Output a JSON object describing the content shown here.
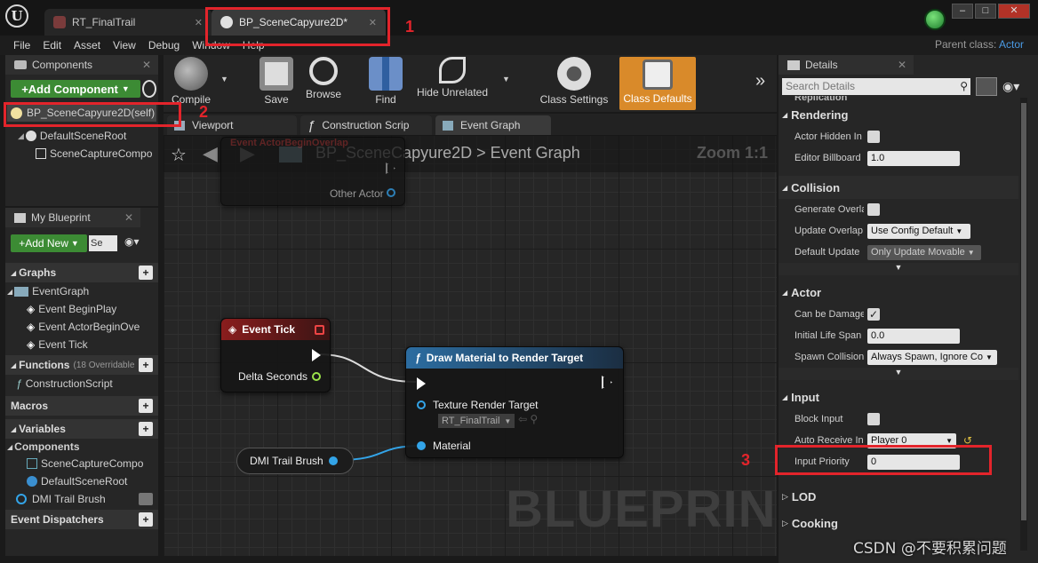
{
  "tabs": [
    {
      "label": "RT_FinalTrail"
    },
    {
      "label": "BP_SceneCapyure2D*"
    }
  ],
  "menu": [
    "File",
    "Edit",
    "Asset",
    "View",
    "Debug",
    "Window",
    "Help"
  ],
  "parent_class": {
    "label": "Parent class:",
    "value": "Actor"
  },
  "components_panel": {
    "title": "Components",
    "add_button": "+Add Component",
    "self_item": "BP_SceneCapyure2D(self)",
    "tree": [
      "DefaultSceneRoot",
      "SceneCaptureCompo"
    ]
  },
  "my_blueprint": {
    "title": "My Blueprint",
    "add_new": "+Add New",
    "search_placeholder": "Se",
    "graphs_label": "Graphs",
    "event_graph": "EventGraph",
    "events": [
      "Event BeginPlay",
      "Event ActorBeginOve",
      "Event Tick"
    ],
    "functions_label": "Functions",
    "functions_note": "(18 Overridable",
    "construction_script": "ConstructionScript",
    "macros_label": "Macros",
    "variables_label": "Variables",
    "components_label": "Components",
    "component_vars": [
      "SceneCaptureCompo",
      "DefaultSceneRoot"
    ],
    "dmi_var": "DMI Trail Brush",
    "dispatchers_label": "Event Dispatchers"
  },
  "toolbar": {
    "compile": "Compile",
    "save": "Save",
    "browse": "Browse",
    "find": "Find",
    "hide_unrelated": "Hide Unrelated",
    "class_settings": "Class Settings",
    "class_defaults": "Class Defaults"
  },
  "graph_tabs": [
    "Viewport",
    "Construction Scrip",
    "Event Graph"
  ],
  "graph": {
    "breadcrumb_bp": "BP_SceneCapyure2D",
    "breadcrumb_sep": ">",
    "breadcrumb_graph": "Event Graph",
    "zoom": "Zoom 1:1",
    "watermark": "BLUEPRINT",
    "ghost_node_title": "Event ActorBeginOverlap",
    "other_actor": "Other Actor",
    "event_tick_title": "Event Tick",
    "delta_seconds": "Delta Seconds",
    "draw_title": "Draw Material to Render Target",
    "texture_rt": "Texture Render Target",
    "texture_rt_value": "RT_FinalTrail",
    "material": "Material",
    "dmi_node": "DMI Trail Brush"
  },
  "details": {
    "title": "Details",
    "search_placeholder": "Search Details",
    "partial_top": "Replication",
    "sections": {
      "rendering": "Rendering",
      "collision": "Collision",
      "actor": "Actor",
      "input": "Input",
      "lod": "LOD",
      "cooking": "Cooking"
    },
    "rows": {
      "actor_hidden": "Actor Hidden In",
      "editor_billboard": "Editor Billboard",
      "editor_billboard_value": "1.0",
      "generate_overlap": "Generate Overla",
      "update_overlap": "Update Overlap",
      "update_overlap_value": "Use Config Default",
      "default_update": "Default Update",
      "default_update_value": "Only Update Movable",
      "can_be_damaged": "Can be Damage",
      "initial_life": "Initial Life Span",
      "initial_life_value": "0.0",
      "spawn_collision": "Spawn Collision",
      "spawn_collision_value": "Always Spawn, Ignore Co",
      "block_input": "Block Input",
      "auto_receive": "Auto Receive In",
      "auto_receive_value": "Player 0",
      "input_priority": "Input Priority",
      "input_priority_value": "0"
    }
  },
  "annotations": [
    "1",
    "2",
    "3"
  ],
  "watermark_text": "CSDN @不要积累问题"
}
